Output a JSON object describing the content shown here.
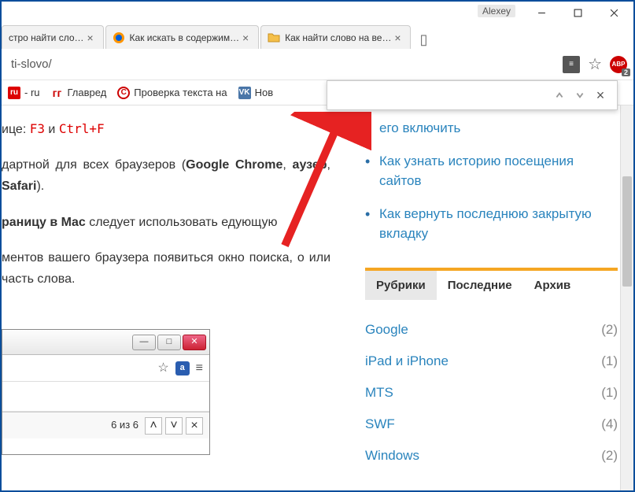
{
  "titlebar": {
    "user": "Alexey"
  },
  "tabs": [
    {
      "title": "стро найти сло…",
      "icon": "generic"
    },
    {
      "title": "Как искать в содержим…",
      "icon": "firefox"
    },
    {
      "title": "Как найти слово на ве…",
      "icon": "folder"
    }
  ],
  "url": {
    "path": "ti-slovo/"
  },
  "abp": {
    "label": "ABP",
    "count": "2"
  },
  "bookmarks": [
    {
      "label": "- ru",
      "icon": "ru"
    },
    {
      "label": "Главред",
      "icon": "glavred"
    },
    {
      "label": "Проверка текста на",
      "icon": "c-circle"
    },
    {
      "label": "Нов",
      "icon": "vk"
    }
  ],
  "findbar": {
    "placeholder": ""
  },
  "content": {
    "line1_pre": "ице: ",
    "kbd1": "F3",
    "and": " и ",
    "kbd2": "Ctrl+F",
    "line2_a": "дартной для всех браузеров (",
    "line2_b": "Google Chrome",
    "line2_c": ", ",
    "line2_d": "аузер",
    "line2_e": ", ",
    "line2_f": "Safari",
    "line2_g": ").",
    "line3_a": "раницу в Mac",
    "line3_b": " следует использовать   едующую",
    "line4": "ментов вашего браузера появиться окно поиска, о или часть слова."
  },
  "sidebar": {
    "partial": "его включить",
    "links": [
      "Как узнать историю посещения сайтов",
      "Как вернуть последнюю закрытую вкладку"
    ],
    "tabs": [
      "Рубрики",
      "Последние",
      "Архив"
    ],
    "categories": [
      {
        "name": "Google",
        "count": "(2)"
      },
      {
        "name": "iPad и iPhone",
        "count": "(1)"
      },
      {
        "name": "MTS",
        "count": "(1)"
      },
      {
        "name": "SWF",
        "count": "(4)"
      },
      {
        "name": "Windows",
        "count": "(2)"
      }
    ]
  },
  "inner": {
    "count": "6 из 6"
  }
}
